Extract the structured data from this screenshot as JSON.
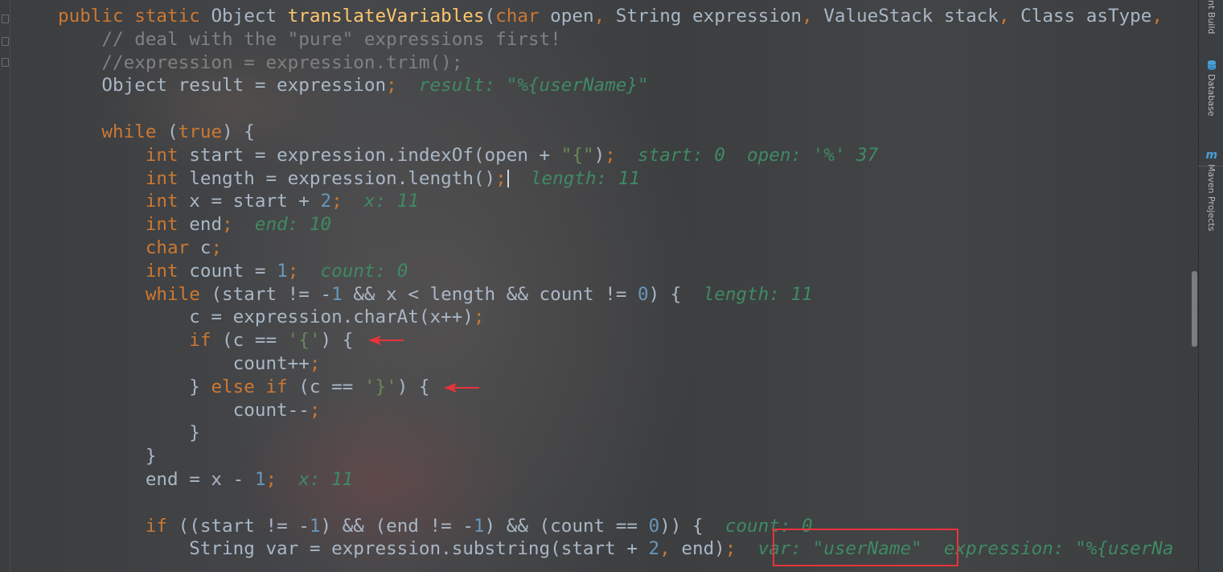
{
  "right_panel": {
    "tabs": [
      {
        "label": "nt Build",
        "icon": "ant-build-icon"
      },
      {
        "label": "Database",
        "icon": "database-icon"
      },
      {
        "label": "Maven Projects",
        "icon": "maven-icon"
      }
    ]
  },
  "editor": {
    "lines": [
      [
        {
          "t": "public static ",
          "c": "kw"
        },
        {
          "t": "Object ",
          "c": "plain"
        },
        {
          "t": "translateVariables",
          "c": "fn"
        },
        {
          "t": "(",
          "c": "plain"
        },
        {
          "t": "char ",
          "c": "kw"
        },
        {
          "t": "open",
          "c": "plain"
        },
        {
          "t": ", ",
          "c": "kw"
        },
        {
          "t": "String expression",
          "c": "plain"
        },
        {
          "t": ", ",
          "c": "kw"
        },
        {
          "t": "ValueStack stack",
          "c": "plain"
        },
        {
          "t": ", ",
          "c": "kw"
        },
        {
          "t": "Class asType",
          "c": "plain"
        },
        {
          "t": ",",
          "c": "kw"
        }
      ],
      [
        {
          "t": "    // deal with the \"pure\" expressions first!",
          "c": "cm"
        }
      ],
      [
        {
          "t": "    //expression = expression.trim();",
          "c": "cm"
        }
      ],
      [
        {
          "t": "    Object result = expression",
          "c": "plain"
        },
        {
          "t": ";",
          "c": "kw"
        },
        {
          "t": "  result: \"%{userName}\"",
          "c": "hint"
        }
      ],
      [],
      [
        {
          "t": "    ",
          "c": "plain"
        },
        {
          "t": "while ",
          "c": "kw"
        },
        {
          "t": "(",
          "c": "plain"
        },
        {
          "t": "true",
          "c": "kw"
        },
        {
          "t": ") {",
          "c": "plain"
        }
      ],
      [
        {
          "t": "        ",
          "c": "plain"
        },
        {
          "t": "int ",
          "c": "kw"
        },
        {
          "t": "start = expression.indexOf(open + ",
          "c": "plain"
        },
        {
          "t": "\"{\"",
          "c": "str"
        },
        {
          "t": ")",
          "c": "plain"
        },
        {
          "t": ";",
          "c": "kw"
        },
        {
          "t": "  start: 0  open: '%' 37",
          "c": "hint"
        }
      ],
      [
        {
          "t": "        ",
          "c": "plain"
        },
        {
          "t": "int ",
          "c": "kw"
        },
        {
          "t": "length = expression.length()",
          "c": "plain"
        },
        {
          "t": ";",
          "c": "kw"
        },
        {
          "t": "CARET",
          "c": "caret"
        },
        {
          "t": "  length: 11",
          "c": "hint"
        }
      ],
      [
        {
          "t": "        ",
          "c": "plain"
        },
        {
          "t": "int ",
          "c": "kw"
        },
        {
          "t": "x = start + ",
          "c": "plain"
        },
        {
          "t": "2",
          "c": "num"
        },
        {
          "t": ";",
          "c": "kw"
        },
        {
          "t": "  x: 11",
          "c": "hint"
        }
      ],
      [
        {
          "t": "        ",
          "c": "plain"
        },
        {
          "t": "int ",
          "c": "kw"
        },
        {
          "t": "end",
          "c": "plain"
        },
        {
          "t": ";",
          "c": "kw"
        },
        {
          "t": "  end: 10",
          "c": "hint"
        }
      ],
      [
        {
          "t": "        ",
          "c": "plain"
        },
        {
          "t": "char ",
          "c": "kw"
        },
        {
          "t": "c",
          "c": "plain"
        },
        {
          "t": ";",
          "c": "kw"
        }
      ],
      [
        {
          "t": "        ",
          "c": "plain"
        },
        {
          "t": "int ",
          "c": "kw"
        },
        {
          "t": "count = ",
          "c": "plain"
        },
        {
          "t": "1",
          "c": "num"
        },
        {
          "t": ";",
          "c": "kw"
        },
        {
          "t": "  count: 0",
          "c": "hint"
        }
      ],
      [
        {
          "t": "        ",
          "c": "plain"
        },
        {
          "t": "while ",
          "c": "kw"
        },
        {
          "t": "(start != -",
          "c": "plain"
        },
        {
          "t": "1 ",
          "c": "num"
        },
        {
          "t": "&& x < length && count != ",
          "c": "plain"
        },
        {
          "t": "0",
          "c": "num"
        },
        {
          "t": ") {",
          "c": "plain"
        },
        {
          "t": "  length: 11",
          "c": "hint"
        }
      ],
      [
        {
          "t": "            c = expression.charAt(x++)",
          "c": "plain"
        },
        {
          "t": ";",
          "c": "kw"
        }
      ],
      [
        {
          "t": "            ",
          "c": "plain"
        },
        {
          "t": "if ",
          "c": "kw"
        },
        {
          "t": "(c == ",
          "c": "plain"
        },
        {
          "t": "'{'",
          "c": "str"
        },
        {
          "t": ") {",
          "c": "plain"
        }
      ],
      [
        {
          "t": "                count++",
          "c": "plain"
        },
        {
          "t": ";",
          "c": "kw"
        }
      ],
      [
        {
          "t": "            } ",
          "c": "plain"
        },
        {
          "t": "else if ",
          "c": "kw"
        },
        {
          "t": "(c == ",
          "c": "plain"
        },
        {
          "t": "'}'",
          "c": "str"
        },
        {
          "t": ") {",
          "c": "plain"
        }
      ],
      [
        {
          "t": "                count--",
          "c": "plain"
        },
        {
          "t": ";",
          "c": "kw"
        }
      ],
      [
        {
          "t": "            }",
          "c": "plain"
        }
      ],
      [
        {
          "t": "        }",
          "c": "plain"
        }
      ],
      [
        {
          "t": "        end = x - ",
          "c": "plain"
        },
        {
          "t": "1",
          "c": "num"
        },
        {
          "t": ";",
          "c": "kw"
        },
        {
          "t": "  x: 11",
          "c": "hint"
        }
      ],
      [],
      [
        {
          "t": "        ",
          "c": "plain"
        },
        {
          "t": "if ",
          "c": "kw"
        },
        {
          "t": "((start != -",
          "c": "plain"
        },
        {
          "t": "1",
          "c": "num"
        },
        {
          "t": ") && (end != -",
          "c": "plain"
        },
        {
          "t": "1",
          "c": "num"
        },
        {
          "t": ") && (count == ",
          "c": "plain"
        },
        {
          "t": "0",
          "c": "num"
        },
        {
          "t": ")) {",
          "c": "plain"
        },
        {
          "t": "  count: 0",
          "c": "hint"
        }
      ],
      [
        {
          "t": "            String var = expression.substring(start + ",
          "c": "plain"
        },
        {
          "t": "2",
          "c": "num"
        },
        {
          "t": ", ",
          "c": "kw"
        },
        {
          "t": "end)",
          "c": "plain"
        },
        {
          "t": ";",
          "c": "kw"
        },
        {
          "t": "  var: \"userName\"  expression: \"%{userNa",
          "c": "hint"
        }
      ]
    ]
  },
  "annotations": {
    "arrow_color": "#e8333b",
    "highlight_color": "#e8333b"
  }
}
